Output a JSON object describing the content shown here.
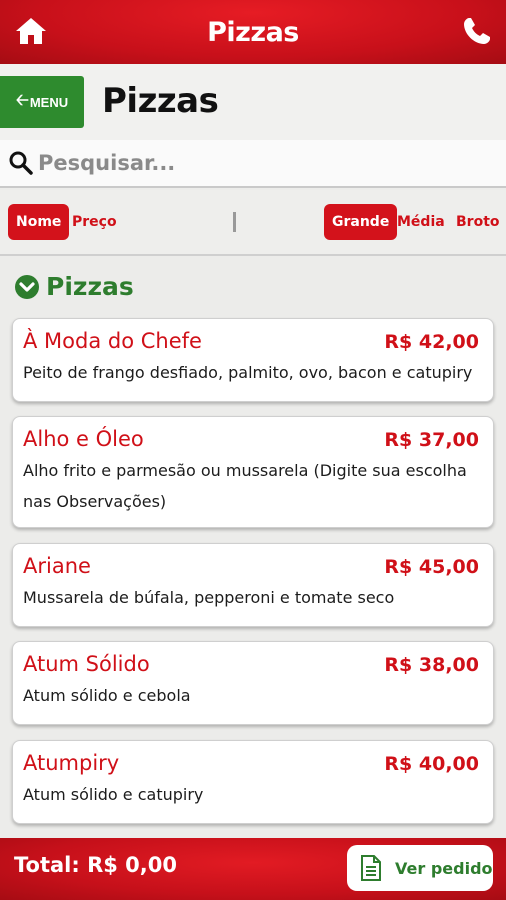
{
  "header": {
    "title": "Pizzas",
    "home_icon": "home-icon",
    "phone_icon": "phone-icon"
  },
  "page": {
    "menu_label": "MENU",
    "title": "Pizzas"
  },
  "search": {
    "placeholder": "Pesquisar..."
  },
  "filters": {
    "sort": [
      {
        "label": "Nome",
        "active": true
      },
      {
        "label": "Preço",
        "active": false
      }
    ],
    "sizes": [
      {
        "label": "Grande",
        "active": true
      },
      {
        "label": "Média",
        "active": false
      },
      {
        "label": "Broto",
        "active": false
      }
    ]
  },
  "section": {
    "label": "Pizzas"
  },
  "items": [
    {
      "name": "À Moda do Chefe",
      "price": "R$ 42,00",
      "desc": "Peito de frango desfiado, palmito, ovo, bacon e catupiry"
    },
    {
      "name": "Alho e Óleo",
      "price": "R$ 37,00",
      "desc": "Alho frito e parmesão ou mussarela (Digite sua escolha nas Observações)"
    },
    {
      "name": "Ariane",
      "price": "R$ 45,00",
      "desc": "Mussarela de búfala, pepperoni e tomate seco"
    },
    {
      "name": "Atum Sólido",
      "price": "R$ 38,00",
      "desc": "Atum sólido e cebola"
    },
    {
      "name": "Atumpiry",
      "price": "R$ 40,00",
      "desc": "Atum sólido e catupiry"
    }
  ],
  "footer": {
    "total": "Total: R$ 0,00",
    "button_label": "Ver pedido"
  },
  "colors": {
    "brand_red": "#d01018",
    "green": "#2e8b2e"
  }
}
